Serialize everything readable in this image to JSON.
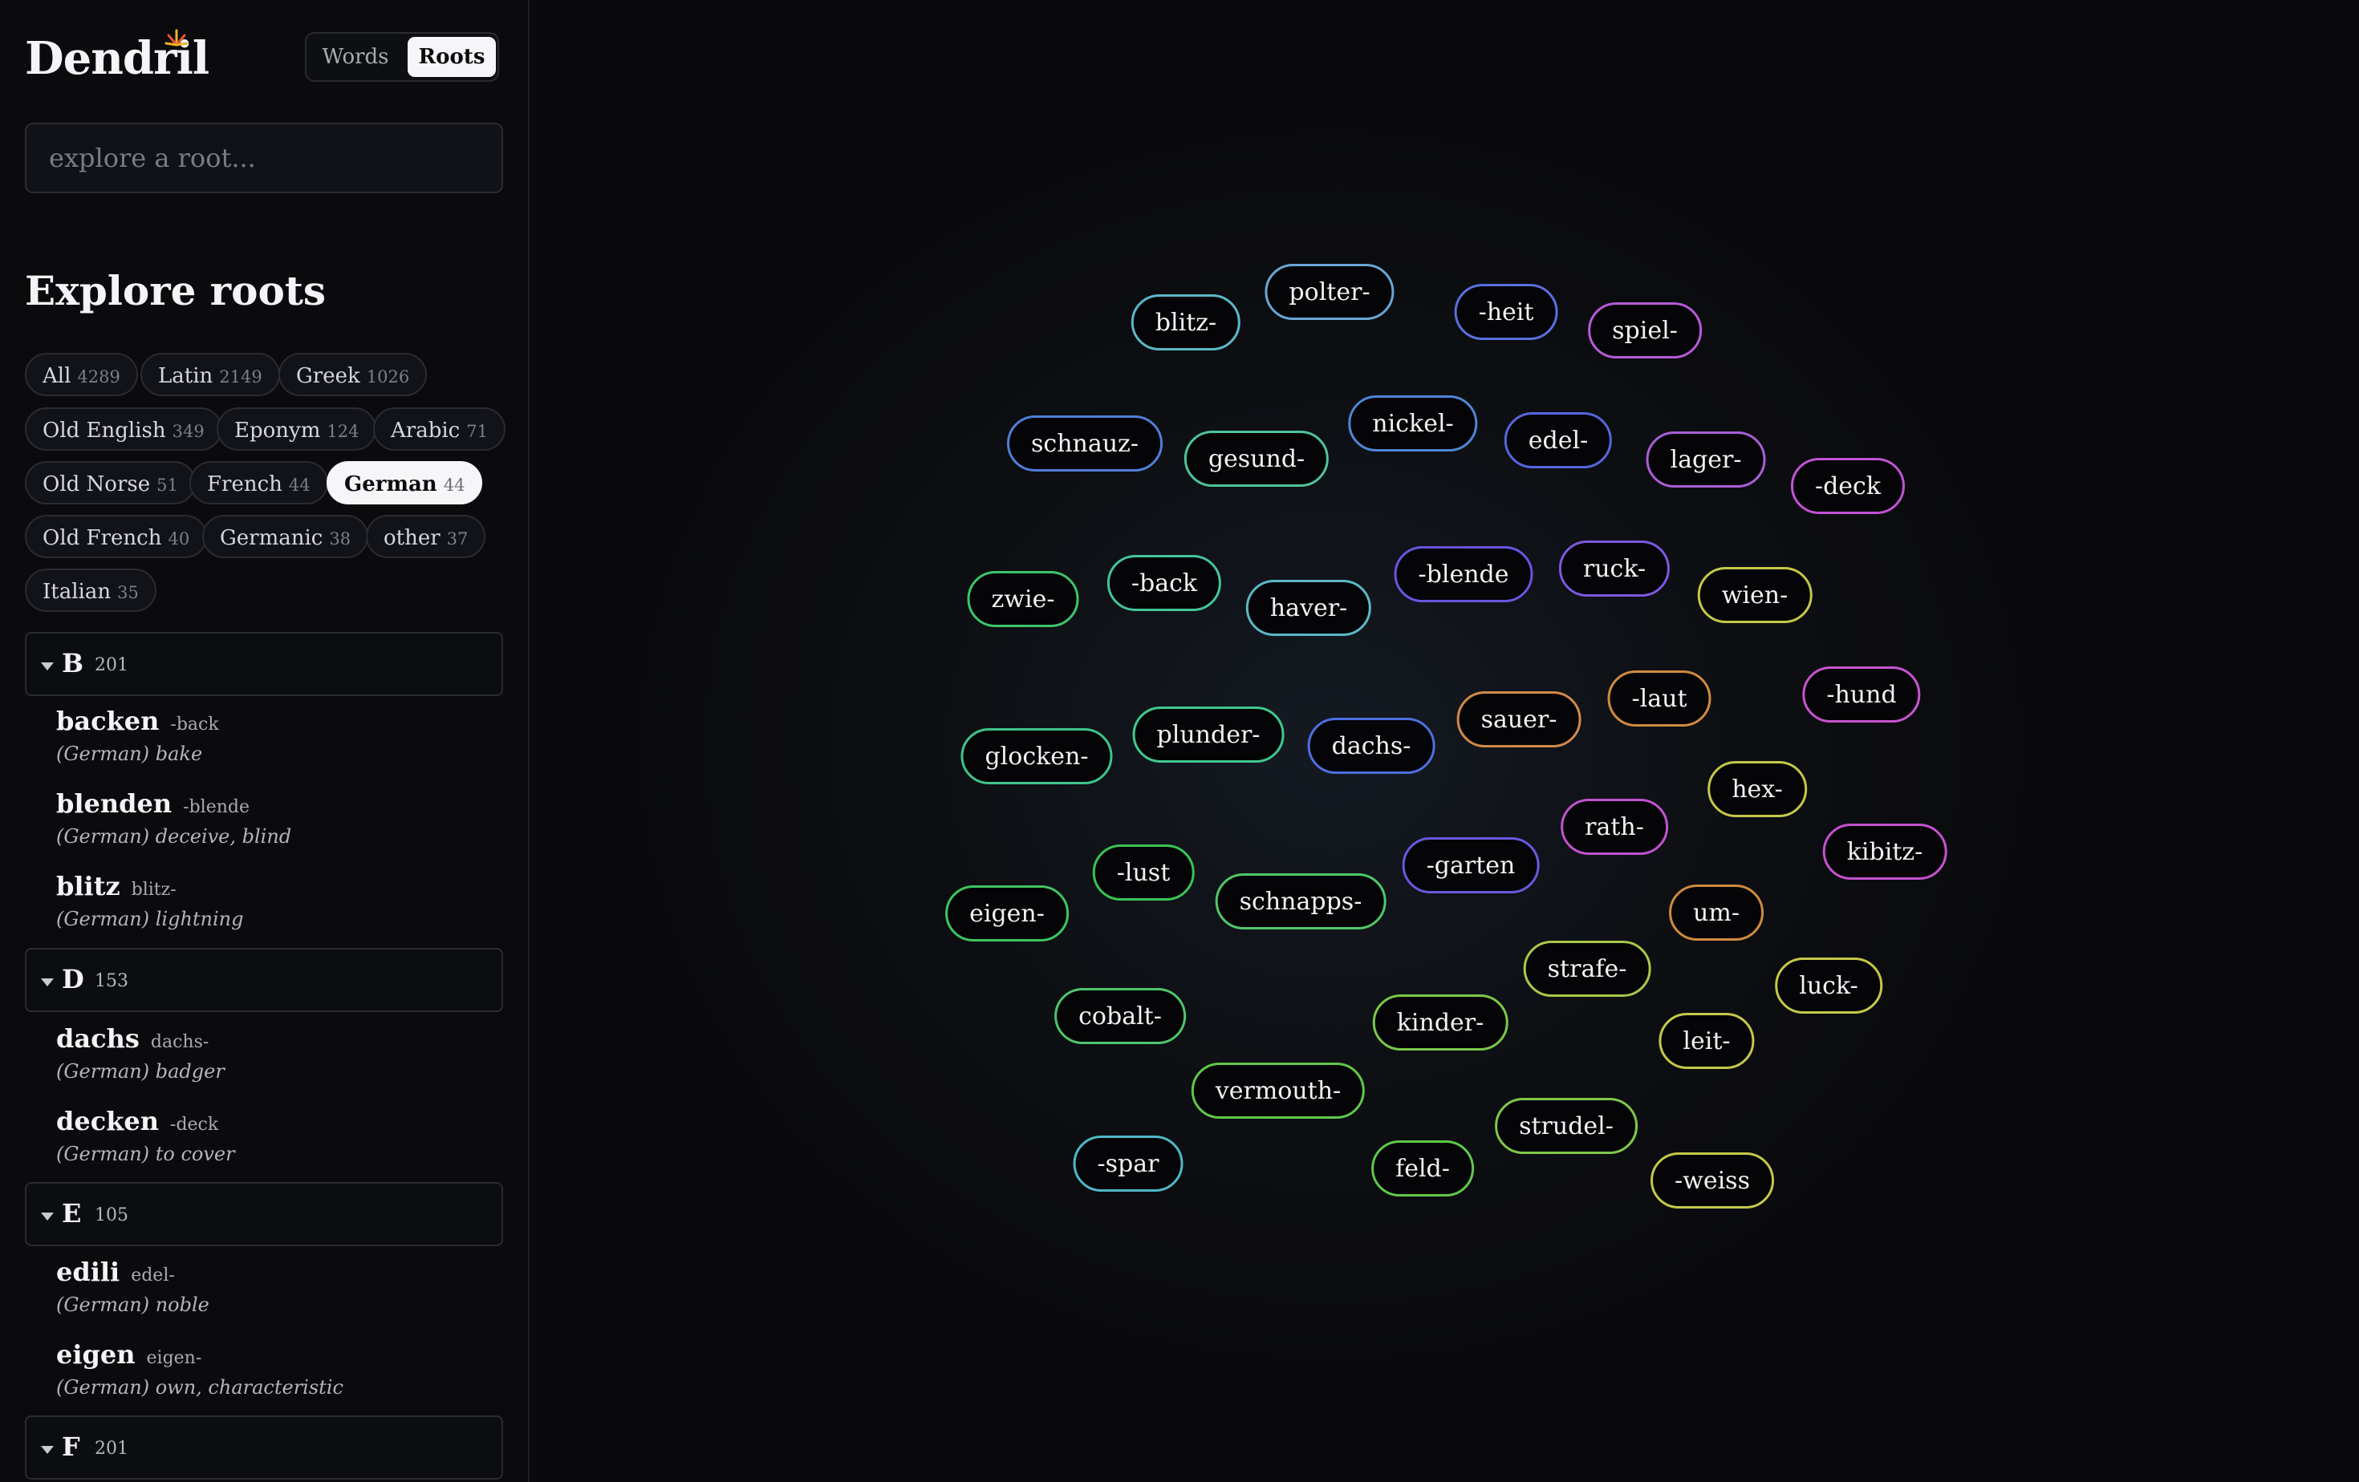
{
  "app": {
    "name": "Dendril"
  },
  "mode_toggle": {
    "words": "Words",
    "roots": "Roots",
    "active": "Roots"
  },
  "search": {
    "placeholder": "explore a root..."
  },
  "explore": {
    "title": "Explore roots",
    "filters": [
      {
        "label": "All",
        "count": "4289"
      },
      {
        "label": "Latin",
        "count": "2149"
      },
      {
        "label": "Greek",
        "count": "1026"
      },
      {
        "label": "Old English",
        "count": "349"
      },
      {
        "label": "Eponym",
        "count": "124"
      },
      {
        "label": "Arabic",
        "count": "71"
      },
      {
        "label": "Old Norse",
        "count": "51"
      },
      {
        "label": "French",
        "count": "44"
      },
      {
        "label": "German",
        "count": "44",
        "active": true
      },
      {
        "label": "Old French",
        "count": "40"
      },
      {
        "label": "Germanic",
        "count": "38"
      },
      {
        "label": "other",
        "count": "37"
      },
      {
        "label": "Italian",
        "count": "35"
      }
    ]
  },
  "groups": [
    {
      "letter": "B",
      "count": "201",
      "entries": [
        {
          "word": "backen",
          "root": "-back",
          "gloss": "(German) bake"
        },
        {
          "word": "blenden",
          "root": "-blende",
          "gloss": "(German) deceive, blind"
        },
        {
          "word": "blitz",
          "root": "blitz-",
          "gloss": "(German) lightning"
        }
      ]
    },
    {
      "letter": "D",
      "count": "153",
      "entries": [
        {
          "word": "dachs",
          "root": "dachs-",
          "gloss": "(German) badger"
        },
        {
          "word": "decken",
          "root": "-deck",
          "gloss": "(German) to cover"
        }
      ]
    },
    {
      "letter": "E",
      "count": "105",
      "entries": [
        {
          "word": "edili",
          "root": "edel-",
          "gloss": "(German) noble"
        },
        {
          "word": "eigen",
          "root": "eigen-",
          "gloss": "(German) own, characteristic"
        }
      ]
    },
    {
      "letter": "F",
      "count": "201",
      "entries": []
    }
  ],
  "graph": {
    "nodes": [
      {
        "label": "polter-",
        "color": "#6aa6d6"
      },
      {
        "label": "blitz-",
        "color": "#5bb8c8"
      },
      {
        "label": "-heit",
        "color": "#5a6fe0"
      },
      {
        "label": "spiel-",
        "color": "#b65ad8"
      },
      {
        "label": "nickel-",
        "color": "#4f86d8"
      },
      {
        "label": "edel-",
        "color": "#5566dd"
      },
      {
        "label": "schnauz-",
        "color": "#4f7fd8"
      },
      {
        "label": "gesund-",
        "color": "#4fc49a"
      },
      {
        "label": "lager-",
        "color": "#a95ed8"
      },
      {
        "label": "-deck",
        "color": "#c253d6"
      },
      {
        "label": "-back",
        "color": "#44c49a"
      },
      {
        "label": "zwie-",
        "color": "#3ec46b"
      },
      {
        "label": "haver-",
        "color": "#5bb8c8"
      },
      {
        "label": "-blende",
        "color": "#6a55e0"
      },
      {
        "label": "ruck-",
        "color": "#7b58e0"
      },
      {
        "label": "wien-",
        "color": "#c5c84a"
      },
      {
        "label": "-hund",
        "color": "#c854d0"
      },
      {
        "label": "-laut",
        "color": "#d08a3e"
      },
      {
        "label": "sauer-",
        "color": "#d28a48"
      },
      {
        "label": "plunder-",
        "color": "#3fc88f"
      },
      {
        "label": "dachs-",
        "color": "#4f6fe0"
      },
      {
        "label": "glocken-",
        "color": "#3fc48c"
      },
      {
        "label": "hex-",
        "color": "#c5c84a"
      },
      {
        "label": "rath-",
        "color": "#c252d0"
      },
      {
        "label": "kibitz-",
        "color": "#c552d0"
      },
      {
        "label": "-lust",
        "color": "#38c455"
      },
      {
        "label": "-garten",
        "color": "#6a58e0"
      },
      {
        "label": "schnapps-",
        "color": "#4fc86a"
      },
      {
        "label": "eigen-",
        "color": "#3ec45f"
      },
      {
        "label": "um-",
        "color": "#d08a3e"
      },
      {
        "label": "strafe-",
        "color": "#a8c84a"
      },
      {
        "label": "luck-",
        "color": "#c5c84a"
      },
      {
        "label": "cobalt-",
        "color": "#4fc46a"
      },
      {
        "label": "kinder-",
        "color": "#7ac84a"
      },
      {
        "label": "leit-",
        "color": "#c5c84a"
      },
      {
        "label": "vermouth-",
        "color": "#5fc84a"
      },
      {
        "label": "strudel-",
        "color": "#7fc84a"
      },
      {
        "label": "-spar",
        "color": "#4fb8c8"
      },
      {
        "label": "feld-",
        "color": "#5fc84a"
      },
      {
        "label": "-weiss",
        "color": "#c5c84a"
      }
    ]
  }
}
